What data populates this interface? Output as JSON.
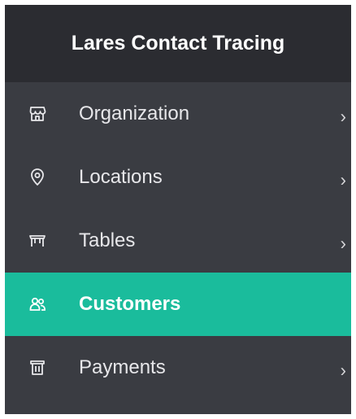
{
  "sidebar": {
    "title": "Lares Contact Tracing",
    "items": [
      {
        "label": "Organization",
        "icon": "store-icon",
        "has_chevron": true,
        "chevron": "›"
      },
      {
        "label": "Locations",
        "icon": "location-pin-icon",
        "has_chevron": true,
        "chevron": "›"
      },
      {
        "label": "Tables",
        "icon": "table-icon",
        "has_chevron": true,
        "chevron": "›"
      },
      {
        "label": "Customers",
        "icon": "users-icon",
        "has_chevron": false,
        "active": true
      },
      {
        "label": "Payments",
        "icon": "payments-icon",
        "has_chevron": true,
        "chevron": "›"
      }
    ]
  },
  "colors": {
    "sidebar_bg": "#3a3c42",
    "header_bg": "#2b2c31",
    "active_bg": "#1abc9c",
    "text": "#e7e7ea"
  }
}
